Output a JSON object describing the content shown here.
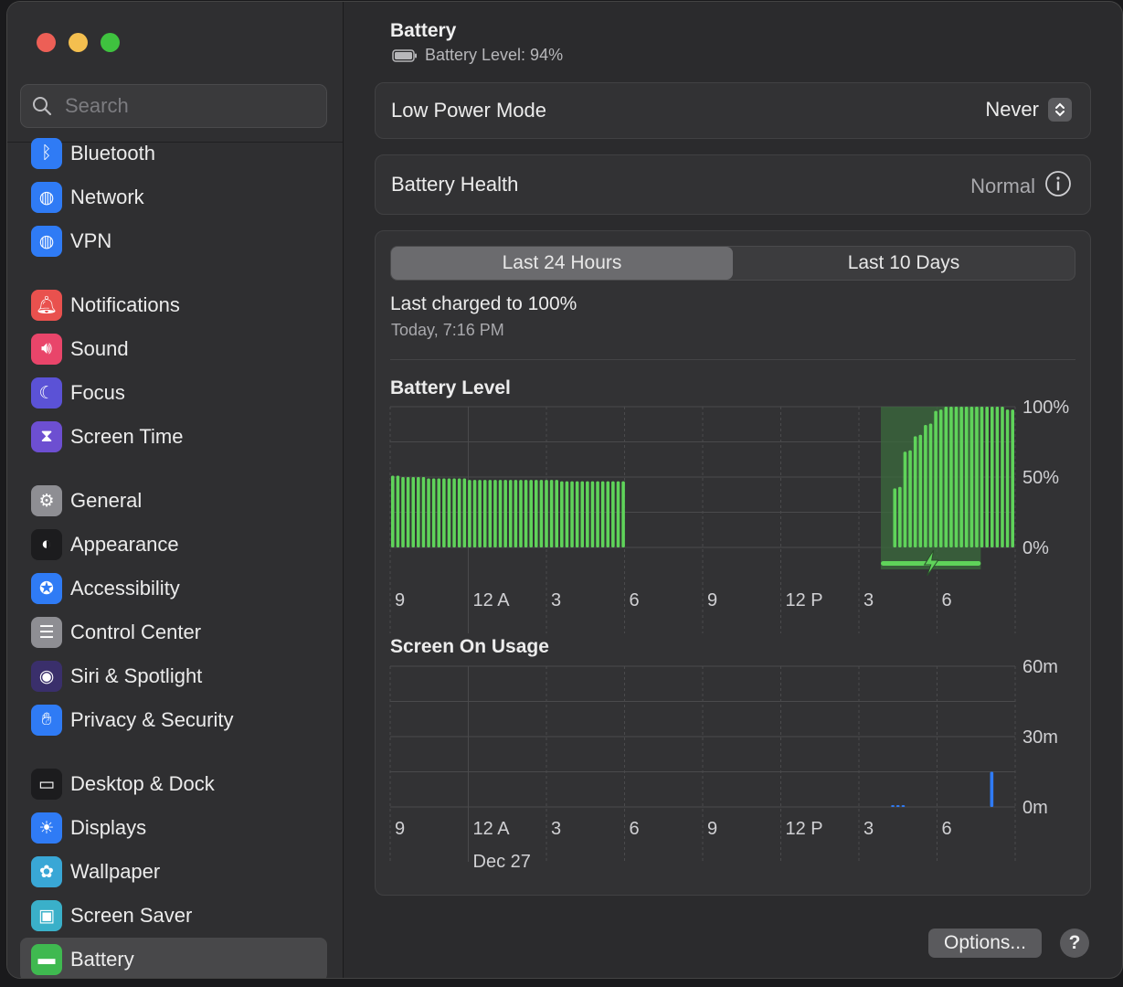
{
  "window": {
    "title": "Battery",
    "subtitle": "Battery Level: 94%"
  },
  "search": {
    "placeholder": "Search"
  },
  "sidebar": {
    "items": [
      {
        "label": "Bluetooth",
        "icon": "bluetooth-icon",
        "color": "#2f7bf5"
      },
      {
        "label": "Network",
        "icon": "globe-icon",
        "color": "#2f7bf5"
      },
      {
        "label": "VPN",
        "icon": "globe-shield-icon",
        "color": "#2f7bf5"
      },
      {
        "label": "Notifications",
        "icon": "bell-icon",
        "color": "#e9514e"
      },
      {
        "label": "Sound",
        "icon": "speaker-icon",
        "color": "#e9456a"
      },
      {
        "label": "Focus",
        "icon": "moon-icon",
        "color": "#5b52d6"
      },
      {
        "label": "Screen Time",
        "icon": "hourglass-icon",
        "color": "#6d4fd1"
      },
      {
        "label": "General",
        "icon": "gear-icon",
        "color": "#8e8e93"
      },
      {
        "label": "Appearance",
        "icon": "appearance-icon",
        "color": "#1c1c1e"
      },
      {
        "label": "Accessibility",
        "icon": "accessibility-icon",
        "color": "#2f7bf5"
      },
      {
        "label": "Control Center",
        "icon": "toggles-icon",
        "color": "#8e8e93"
      },
      {
        "label": "Siri & Spotlight",
        "icon": "siri-icon",
        "color": "#3a2f6b"
      },
      {
        "label": "Privacy & Security",
        "icon": "hand-icon",
        "color": "#2f7bf5"
      },
      {
        "label": "Desktop & Dock",
        "icon": "dock-icon",
        "color": "#1c1c1e"
      },
      {
        "label": "Displays",
        "icon": "sun-icon",
        "color": "#2f7bf5"
      },
      {
        "label": "Wallpaper",
        "icon": "flower-icon",
        "color": "#39a7d6"
      },
      {
        "label": "Screen Saver",
        "icon": "screensaver-icon",
        "color": "#3ab0c9"
      },
      {
        "label": "Battery",
        "icon": "battery-icon",
        "color": "#3fb950"
      }
    ],
    "selected": "Battery"
  },
  "low_power": {
    "label": "Low Power Mode",
    "value": "Never"
  },
  "health": {
    "label": "Battery Health",
    "value": "Normal"
  },
  "tabs": {
    "last24": "Last 24 Hours",
    "last10": "Last 10 Days",
    "active": "Last 24 Hours"
  },
  "charged": {
    "text": "Last charged to 100%",
    "time": "Today, 7:16 PM"
  },
  "buttons": {
    "options": "Options...",
    "help": "?"
  },
  "colors": {
    "battery_bar": "#5fd35a",
    "charging_bg": "#3b6b3c",
    "usage_bar": "#2f7bf5",
    "grid": "#4a4a4c"
  },
  "chart_data": [
    {
      "type": "bar",
      "title": "Battery Level",
      "x_tick_labels": [
        "9",
        "12 A",
        "3",
        "6",
        "9",
        "12 P",
        "3",
        "6"
      ],
      "ylim": [
        0,
        100
      ],
      "y_tick_labels": [
        "100%",
        "50%",
        "0%"
      ],
      "unit": "%",
      "values": [
        51,
        51,
        50,
        50,
        50,
        50,
        50,
        49,
        49,
        49,
        49,
        49,
        49,
        49,
        49,
        48,
        48,
        48,
        48,
        48,
        48,
        48,
        48,
        48,
        48,
        48,
        48,
        48,
        48,
        48,
        48,
        48,
        48,
        47,
        47,
        47,
        47,
        47,
        47,
        47,
        47,
        47,
        47,
        47,
        47,
        47,
        0,
        0,
        0,
        0,
        0,
        0,
        0,
        0,
        0,
        0,
        0,
        0,
        0,
        0,
        0,
        0,
        0,
        0,
        0,
        0,
        0,
        0,
        0,
        0,
        0,
        0,
        0,
        0,
        0,
        0,
        0,
        0,
        0,
        0,
        0,
        0,
        0,
        0,
        0,
        0,
        0,
        0,
        0,
        0,
        0,
        0,
        0,
        0,
        0,
        0,
        0,
        0,
        42,
        43,
        68,
        69,
        79,
        80,
        87,
        88,
        97,
        98,
        100,
        100,
        100,
        100,
        100,
        100,
        100,
        100,
        100,
        100,
        100,
        100,
        98,
        98
      ],
      "charging_range": [
        96,
        115
      ]
    },
    {
      "type": "bar",
      "title": "Screen On Usage",
      "x_tick_labels": [
        "9",
        "12 A",
        "3",
        "6",
        "9",
        "12 P",
        "3",
        "6"
      ],
      "date_label": "Dec 27",
      "ylim": [
        0,
        60
      ],
      "y_tick_labels": [
        "60m",
        "30m",
        "0m"
      ],
      "unit": "minutes",
      "values": [
        0,
        0,
        0,
        0,
        0,
        0,
        0,
        0,
        0,
        0,
        0,
        0,
        0,
        0,
        0,
        0,
        0,
        0,
        0,
        0,
        0,
        0,
        0,
        0,
        0,
        0,
        0,
        0,
        0,
        0,
        0,
        0,
        0,
        0,
        0,
        0,
        0,
        0,
        0,
        0,
        0,
        0,
        0,
        0,
        0,
        0,
        0,
        0,
        0,
        0,
        0,
        0,
        0,
        0,
        0,
        0,
        0,
        0,
        0,
        0,
        0,
        0,
        0,
        0,
        0,
        0,
        0,
        0,
        0,
        0,
        0,
        0,
        0,
        0,
        0,
        0,
        0,
        0,
        0,
        0,
        0,
        0,
        0,
        0,
        0,
        0,
        0,
        0,
        0,
        0,
        0,
        0,
        0,
        0,
        0,
        0,
        0.3,
        0.3,
        0.3,
        0,
        0,
        0,
        0,
        0,
        0,
        0,
        0,
        0,
        0,
        0,
        0,
        0,
        0,
        0,
        0,
        15,
        0,
        0,
        0,
        0
      ]
    }
  ]
}
